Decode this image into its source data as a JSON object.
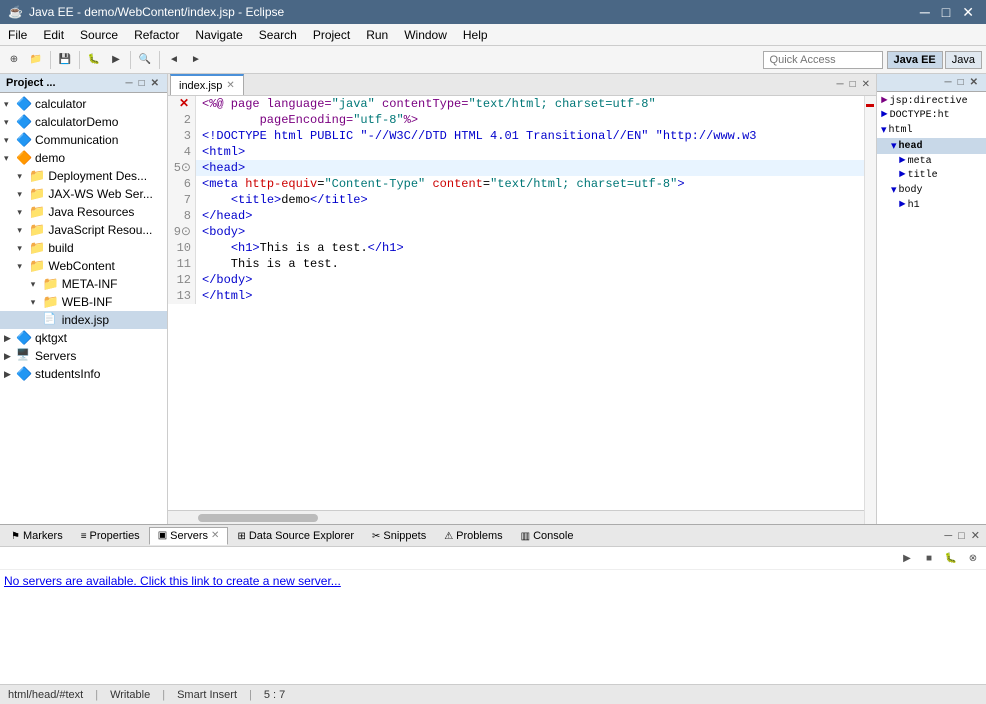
{
  "titleBar": {
    "title": "Java EE - demo/WebContent/index.jsp - Eclipse",
    "minimize": "─",
    "restore": "□",
    "close": "✕"
  },
  "menuBar": {
    "items": [
      "File",
      "Edit",
      "Source",
      "Refactor",
      "Navigate",
      "Search",
      "Project",
      "Run",
      "Window",
      "Help"
    ]
  },
  "toolbar": {
    "quickAccess": {
      "placeholder": "Quick Access",
      "label": "Quick Access"
    },
    "perspectives": [
      {
        "label": "Java EE",
        "active": true
      },
      {
        "label": "Java",
        "active": false
      }
    ]
  },
  "leftPanel": {
    "title": "Project ...",
    "treeItems": [
      {
        "indent": 0,
        "arrow": "▾",
        "icon": "project",
        "label": "calculator",
        "depth": 1
      },
      {
        "indent": 0,
        "arrow": "▾",
        "icon": "project",
        "label": "calculatorDemo",
        "depth": 1
      },
      {
        "indent": 0,
        "arrow": "▾",
        "icon": "project",
        "label": "Communication",
        "depth": 1,
        "selected": false
      },
      {
        "indent": 0,
        "arrow": "▾",
        "icon": "demo",
        "label": "demo",
        "depth": 1
      },
      {
        "indent": 1,
        "arrow": "▾",
        "icon": "folder",
        "label": "Deployment Des...",
        "depth": 2
      },
      {
        "indent": 1,
        "arrow": "▾",
        "icon": "folder",
        "label": "JAX-WS Web Ser...",
        "depth": 2
      },
      {
        "indent": 1,
        "arrow": "▾",
        "icon": "folder",
        "label": "Java Resources",
        "depth": 2
      },
      {
        "indent": 1,
        "arrow": "▾",
        "icon": "folder",
        "label": "JavaScript Resou...",
        "depth": 2
      },
      {
        "indent": 1,
        "arrow": "▾",
        "icon": "folder",
        "label": "build",
        "depth": 2
      },
      {
        "indent": 1,
        "arrow": "▾",
        "icon": "folder",
        "label": "WebContent",
        "depth": 2
      },
      {
        "indent": 2,
        "arrow": "▾",
        "icon": "folder",
        "label": "META-INF",
        "depth": 3
      },
      {
        "indent": 2,
        "arrow": "▾",
        "icon": "folder",
        "label": "WEB-INF",
        "depth": 3
      },
      {
        "indent": 2,
        "arrow": " ",
        "icon": "file",
        "label": "index.jsp",
        "depth": 3,
        "selected": true
      },
      {
        "indent": 0,
        "arrow": "▶",
        "icon": "project",
        "label": "qktgxt",
        "depth": 1
      },
      {
        "indent": 0,
        "arrow": "▶",
        "icon": "server",
        "label": "Servers",
        "depth": 1
      },
      {
        "indent": 0,
        "arrow": "▶",
        "icon": "project",
        "label": "studentsInfo",
        "depth": 1
      }
    ]
  },
  "editor": {
    "tab": "index.jsp",
    "lines": [
      {
        "num": 1,
        "code": "<%@ page language=\"java\" contentType=\"text/html; charset=utf-8\"",
        "type": "directive"
      },
      {
        "num": 2,
        "code": "        pageEncoding=\"utf-8\"%>",
        "type": "directive"
      },
      {
        "num": 3,
        "code": "<!DOCTYPE html PUBLIC \"-//W3C//DTD HTML 4.01 Transitional//EN\" \"http://www.w3",
        "type": "doctype"
      },
      {
        "num": 4,
        "code": "<html>",
        "type": "tag"
      },
      {
        "num": 5,
        "code": "<head>",
        "type": "tag",
        "highlight": true
      },
      {
        "num": 6,
        "code": "<meta http-equiv=\"Content-Type\" content=\"text/html; charset=utf-8\">",
        "type": "tag"
      },
      {
        "num": 7,
        "code": "    <title>demo</title>",
        "type": "tag"
      },
      {
        "num": 8,
        "code": "</head>",
        "type": "tag"
      },
      {
        "num": 9,
        "code": "<body>",
        "type": "tag"
      },
      {
        "num": 10,
        "code": "    <h1>This is a test.</h1>",
        "type": "tag"
      },
      {
        "num": 11,
        "code": "    This is a test.",
        "type": "text"
      },
      {
        "num": 12,
        "code": "</body>",
        "type": "tag"
      },
      {
        "num": 13,
        "code": "</html>",
        "type": "tag"
      }
    ]
  },
  "rightPanel": {
    "title": "",
    "items": [
      {
        "indent": 0,
        "label": "jsp:directive",
        "icon": "►"
      },
      {
        "indent": 0,
        "label": "DOCTYPE:ht",
        "icon": "►"
      },
      {
        "indent": 0,
        "label": "html",
        "icon": "▾"
      },
      {
        "indent": 1,
        "label": "head",
        "icon": "▾",
        "selected": true
      },
      {
        "indent": 2,
        "label": "meta",
        "icon": "►"
      },
      {
        "indent": 2,
        "label": "title",
        "icon": "►"
      },
      {
        "indent": 1,
        "label": "body",
        "icon": "▾"
      },
      {
        "indent": 2,
        "label": "h1",
        "icon": "►"
      }
    ]
  },
  "bottomTabs": [
    {
      "label": "Markers",
      "icon": "⚑",
      "active": false
    },
    {
      "label": "Properties",
      "icon": "≡",
      "active": false
    },
    {
      "label": "Servers",
      "icon": "▣",
      "active": true
    },
    {
      "label": "Data Source Explorer",
      "icon": "⊞",
      "active": false
    },
    {
      "label": "Snippets",
      "icon": "✂",
      "active": false
    },
    {
      "label": "Problems",
      "icon": "⚠",
      "active": false
    },
    {
      "label": "Console",
      "icon": "▥",
      "active": false
    }
  ],
  "bottomContent": {
    "serverMessage": "No servers are available. Click this link to create a new server..."
  },
  "statusBar": {
    "path": "html/head/#text",
    "mode": "Writable",
    "insertMode": "Smart Insert",
    "position": "5 : 7"
  }
}
